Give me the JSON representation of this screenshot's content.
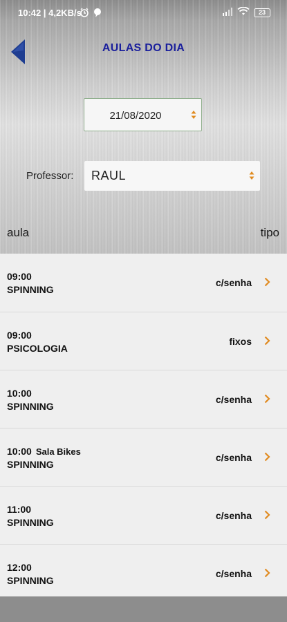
{
  "status": {
    "time": "10:42 | 4,2KB/s",
    "battery": "23"
  },
  "header": {
    "title": "AULAS DO DIA",
    "back_icon": "back-arrow-icon"
  },
  "date_filter": {
    "value": "21/08/2020"
  },
  "professor_filter": {
    "label": "Professor:",
    "value": "RAUL"
  },
  "columns": {
    "aula": "aula",
    "tipo": "tipo"
  },
  "classes": [
    {
      "time": "09:00",
      "room": "",
      "name": "SPINNING",
      "tipo": "c/senha"
    },
    {
      "time": "09:00",
      "room": "",
      "name": "PSICOLOGIA",
      "tipo": "fixos"
    },
    {
      "time": "10:00",
      "room": "",
      "name": "SPINNING",
      "tipo": "c/senha"
    },
    {
      "time": "10:00",
      "room": "Sala Bikes",
      "name": "SPINNING",
      "tipo": "c/senha"
    },
    {
      "time": "11:00",
      "room": "",
      "name": "SPINNING",
      "tipo": "c/senha"
    },
    {
      "time": "12:00",
      "room": "",
      "name": "SPINNING",
      "tipo": "c/senha"
    }
  ],
  "colors": {
    "title": "#1a1f9c",
    "back_arrow": "#1e3d91",
    "chevron": "#e08a1e",
    "spinner": "#e08a1e"
  }
}
